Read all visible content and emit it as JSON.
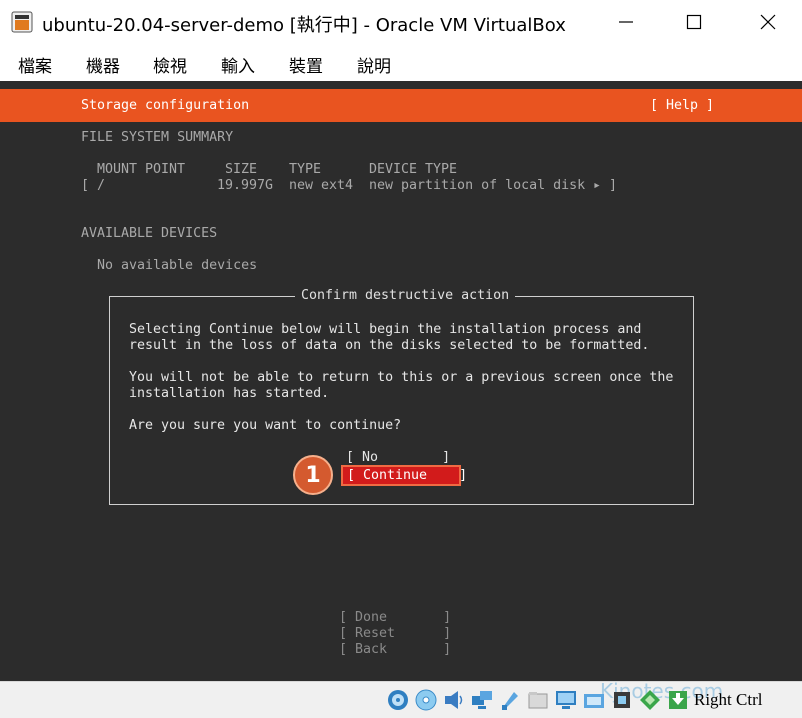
{
  "window": {
    "title": "ubuntu-20.04-server-demo [執行中] - Oracle VM VirtualBox",
    "menu": [
      "檔案",
      "機器",
      "檢視",
      "輸入",
      "裝置",
      "說明"
    ]
  },
  "installer": {
    "header_title": "Storage configuration",
    "help_label": "[ Help ]",
    "fs_summary_heading": "FILE SYSTEM SUMMARY",
    "table_headers": [
      "MOUNT POINT",
      "SIZE",
      "TYPE",
      "DEVICE TYPE"
    ],
    "rows": [
      {
        "open": "[",
        "mount": "/",
        "size": "19.997G",
        "type": "new ext4",
        "device_type": "new partition of local disk",
        "arrow": "▸ ]"
      }
    ],
    "available_heading": "AVAILABLE DEVICES",
    "no_devices": "No available devices",
    "bottom_buttons": [
      "[ Done       ]",
      "[ Reset      ]",
      "[ Back       ]"
    ]
  },
  "dialog": {
    "title": "Confirm destructive action",
    "para1_line1": "Selecting Continue below will begin the installation process and",
    "para1_line2": "result in the loss of data on the disks selected to be formatted.",
    "para2_line1": "You will not be able to return to this or a previous screen once the",
    "para2_line2": "installation has started.",
    "question": "Are you sure you want to continue?",
    "no_label": "[ No        ]",
    "continue_label": "[ Continue    ]",
    "step_marker": "1"
  },
  "statusbar": {
    "host_key": "Right Ctrl",
    "watermark": "Kjnotes.com",
    "icons": [
      "hard-disk-icon",
      "optical-disk-icon",
      "audio-icon",
      "network-icon",
      "usb-icon",
      "shared-folder-icon",
      "display-icon",
      "recording-icon",
      "cpu-icon",
      "mouse-integration-icon",
      "keyboard-capture-icon"
    ]
  },
  "colors": {
    "banner": "#e95420",
    "terminal_bg": "#2c2c2c",
    "continue_bg": "#d21b1b",
    "marker": "#d45a2f"
  }
}
